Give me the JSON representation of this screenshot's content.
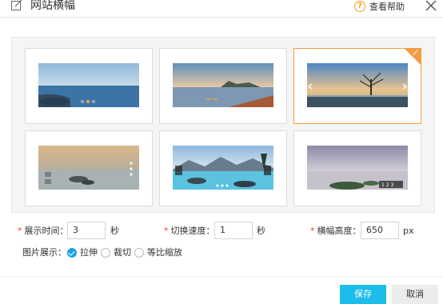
{
  "header": {
    "title": "网站横幅",
    "help_label": "查看帮助"
  },
  "carousel": {
    "selected_index": 2
  },
  "form": {
    "duration_label": "展示时间：",
    "duration_value": "3",
    "duration_unit": "秒",
    "speed_label": "切换速度：",
    "speed_value": "1",
    "speed_unit": "秒",
    "height_label": "横幅高度：",
    "height_value": "650",
    "height_unit": "px",
    "display_label": "图片展示：",
    "display_options": [
      "拉伸",
      "裁切",
      "等比缩放"
    ],
    "display_selected": "拉伸"
  },
  "footer": {
    "save_label": "保存",
    "cancel_label": "取消"
  },
  "colors": {
    "accent_blue": "#1dbde9",
    "select_orange": "#f39c42",
    "required_red": "#e64340"
  }
}
